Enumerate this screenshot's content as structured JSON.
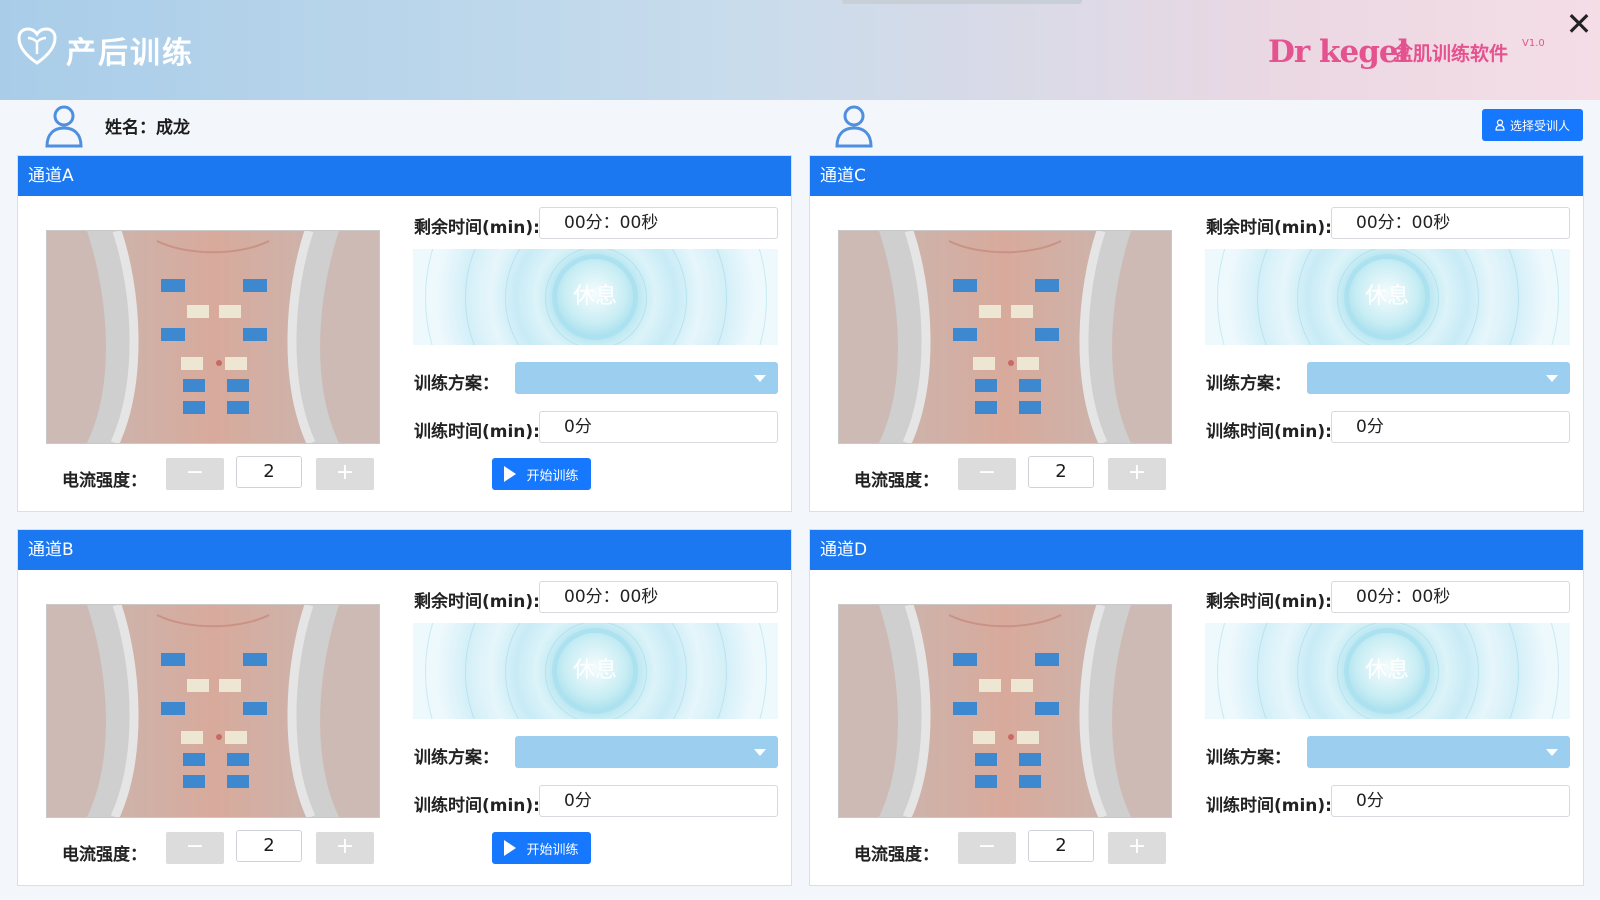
{
  "app": {
    "title": "产后训练",
    "brand": "Dr kegel",
    "brand_subtitle": "盆肌训练软件",
    "version": "V1.0",
    "close_glyph": "✕"
  },
  "patient": {
    "name_label": "姓名：",
    "name": "成龙",
    "select_button": "选择受训人"
  },
  "channels": [
    {
      "header": "通道A",
      "remaining_label": "剩余时间(min):",
      "remaining_value": "00分：00秒",
      "rest_label": "休息",
      "plan_label": "训练方案：",
      "plan_value": "",
      "train_time_label": "训练时间(min):",
      "train_time_value": "0分",
      "current_label": "电流强度：",
      "minus": "−",
      "plus": "+",
      "current_value": "2",
      "start_label": "开始训练"
    },
    {
      "header": "通道C",
      "remaining_label": "剩余时间(min):",
      "remaining_value": "00分：00秒",
      "rest_label": "休息",
      "plan_label": "训练方案：",
      "plan_value": "",
      "train_time_label": "训练时间(min):",
      "train_time_value": "0分",
      "current_label": "电流强度：",
      "minus": "−",
      "plus": "+",
      "current_value": "2"
    },
    {
      "header": "通道B",
      "remaining_label": "剩余时间(min):",
      "remaining_value": "00分：00秒",
      "rest_label": "休息",
      "plan_label": "训练方案：",
      "plan_value": "",
      "train_time_label": "训练时间(min):",
      "train_time_value": "0分",
      "current_label": "电流强度：",
      "minus": "−",
      "plus": "+",
      "current_value": "2",
      "start_label": "开始训练"
    },
    {
      "header": "通道D",
      "remaining_label": "剩余时间(min):",
      "remaining_value": "00分：00秒",
      "rest_label": "休息",
      "plan_label": "训练方案：",
      "plan_value": "",
      "train_time_label": "训练时间(min):",
      "train_time_value": "0分",
      "current_label": "电流强度：",
      "minus": "−",
      "plus": "+",
      "current_value": "2"
    }
  ],
  "icons": {
    "logo": "heart-shield-icon",
    "user": "user-icon",
    "close": "close-icon",
    "play": "play-icon",
    "dropdown": "chevron-down-icon"
  },
  "colors": {
    "primary": "#1677ff",
    "panel_header": "#1c78f0",
    "brand": "#e4538f",
    "select_fill": "#9ccfef"
  }
}
